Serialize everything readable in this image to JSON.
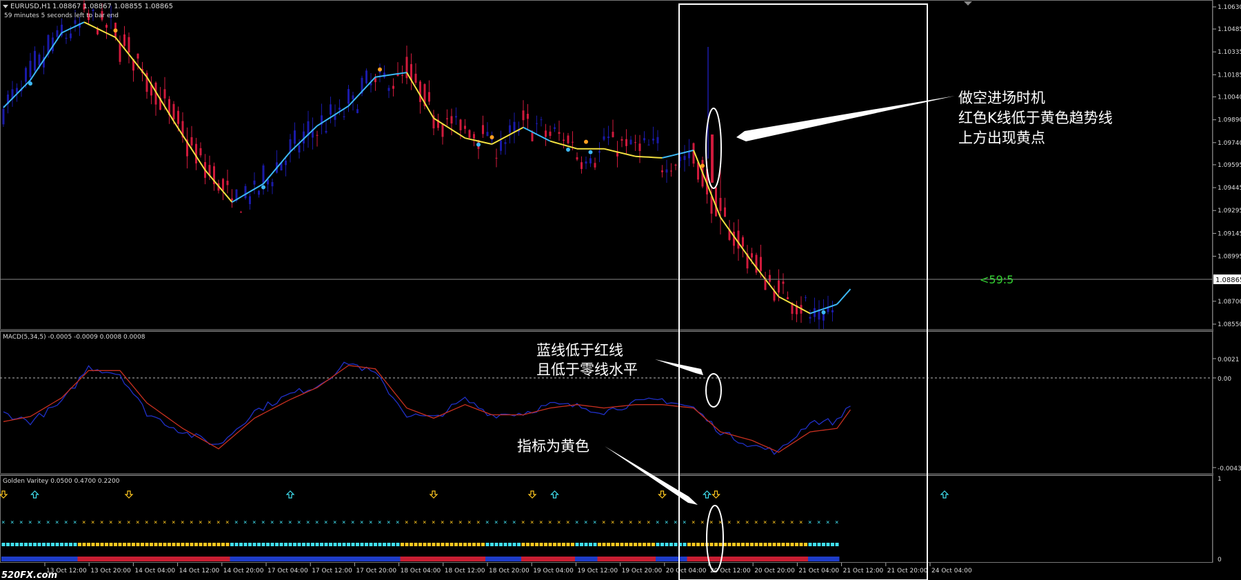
{
  "header": {
    "symbol": "EURUSD,H1",
    "ohlc": "1.08867 1.08867 1.08855 1.08865",
    "countdown": "59 minutes 5 seconds left to bar end",
    "countdown_short": "<59:5"
  },
  "price_panel": {
    "axis_labels": [
      "1.10630",
      "1.10485",
      "1.10335",
      "1.10185",
      "1.10040",
      "1.09890",
      "1.09740",
      "1.09595",
      "1.09445",
      "1.09295",
      "1.09145",
      "1.08995",
      "1.08865",
      "1.08700",
      "1.08550"
    ],
    "current_price": "1.08865",
    "annotation": [
      "做空进场时机",
      "红色K线低于黄色趋势线",
      "上方出现黄点"
    ]
  },
  "macd_panel": {
    "title": "MACD(5,34,5) -0.0005 -0.0009 0.0008 0.0008",
    "axis_labels": [
      "0.0021",
      "0.00",
      "-0.0043"
    ],
    "annotation": [
      "蓝线低于红线",
      "且低于零线水平"
    ]
  },
  "gv_panel": {
    "title": "Golden Varitey 0.0500 0.4700 0.2200",
    "axis_labels": [
      "1",
      "0"
    ],
    "annotation": [
      "指标为黄色"
    ]
  },
  "time_axis": {
    "labels": [
      "13 Oct 12:00",
      "13 Oct 20:00",
      "14 Oct 04:00",
      "14 Oct 12:00",
      "14 Oct 20:00",
      "17 Oct 04:00",
      "17 Oct 12:00",
      "17 Oct 20:00",
      "18 Oct 04:00",
      "18 Oct 12:00",
      "18 Oct 20:00",
      "19 Oct 04:00",
      "19 Oct 12:00",
      "19 Oct 20:00",
      "20 Oct 04:00",
      "20 Oct 12:00",
      "20 Oct 20:00",
      "21 Oct 04:00",
      "21 Oct 12:00",
      "21 Oct 20:00",
      "24 Oct 04:00"
    ]
  },
  "watermark": "520FX.com",
  "colors": {
    "up_candle": "#1a1aa8",
    "down_candle": "#d01a3c",
    "trend_up": "#3db8f5",
    "trend_down": "#f2e040",
    "macd_main": "#2030c8",
    "macd_signal": "#c83020",
    "gv_yellow": "#ffc820",
    "gv_cyan": "#40e0f0",
    "gv_red": "#c81e32",
    "gv_blue": "#1e3cc8"
  },
  "chart_data": {
    "type": "line",
    "trend_line": {
      "x": [
        0,
        6,
        13,
        18,
        25,
        32,
        38,
        45,
        51,
        58,
        64,
        70,
        77,
        83,
        90,
        96,
        103,
        109,
        116,
        122,
        128,
        134,
        141,
        147,
        154,
        160,
        167,
        173,
        180,
        186,
        189
      ],
      "y": [
        1.0997,
        1.1015,
        1.1046,
        1.1053,
        1.1043,
        1.1017,
        1.0988,
        1.0956,
        1.0935,
        1.0947,
        1.0968,
        1.0985,
        1.0998,
        1.1017,
        1.102,
        1.099,
        1.0977,
        1.0973,
        1.0984,
        1.0975,
        1.097,
        1.097,
        1.0965,
        1.0964,
        1.0969,
        1.0925,
        1.0896,
        1.0873,
        1.0862,
        1.0868,
        1.0878
      ],
      "color_by_segment": [
        "up",
        "up",
        "up",
        "down",
        "down",
        "down",
        "down",
        "down",
        "up",
        "up",
        "up",
        "up",
        "up",
        "up",
        "down",
        "down",
        "down",
        "down",
        "up",
        "down",
        "down",
        "down",
        "down",
        "up",
        "down",
        "down",
        "down",
        "down",
        "up",
        "up"
      ]
    },
    "macd_main": {
      "x": [
        0,
        6,
        13,
        19,
        26,
        32,
        40,
        48,
        56,
        64,
        70,
        77,
        83,
        90,
        96,
        103,
        109,
        116,
        122,
        128,
        134,
        141,
        147,
        154,
        160,
        167,
        173,
        180,
        186,
        189
      ],
      "y": [
        -0.0011,
        -0.0016,
        -0.0005,
        0.0016,
        0.0012,
        -0.0011,
        -0.0022,
        -0.003,
        -0.001,
        0.0,
        0.0005,
        0.0019,
        0.0012,
        -0.0012,
        -0.0014,
        -0.0003,
        -0.0012,
        -0.0011,
        -0.0006,
        -0.0007,
        -0.001,
        -0.0005,
        -0.0003,
        -0.0008,
        -0.0022,
        -0.003,
        -0.0034,
        -0.0016,
        -0.0016,
        -0.0005
      ]
    },
    "macd_signal": {
      "x": [
        0,
        6,
        13,
        19,
        26,
        32,
        40,
        48,
        56,
        64,
        70,
        77,
        83,
        90,
        96,
        103,
        109,
        116,
        122,
        128,
        134,
        141,
        147,
        154,
        160,
        167,
        173,
        180,
        186,
        189
      ],
      "y": [
        -0.0016,
        -0.0013,
        -0.0002,
        0.0014,
        0.0014,
        -0.0005,
        -0.002,
        -0.0032,
        -0.0014,
        -0.0003,
        0.0004,
        0.0017,
        0.0015,
        -0.0008,
        -0.0014,
        -0.0006,
        -0.0012,
        -0.0012,
        -0.0008,
        -0.0006,
        -0.0008,
        -0.0006,
        -0.0006,
        -0.0008,
        -0.0022,
        -0.0027,
        -0.0034,
        -0.0022,
        -0.002,
        -0.0009
      ]
    },
    "ylim_price": [
      1.0855,
      1.1063
    ],
    "ylim_macd": [
      -0.0043,
      0.0021
    ],
    "grid": false
  }
}
